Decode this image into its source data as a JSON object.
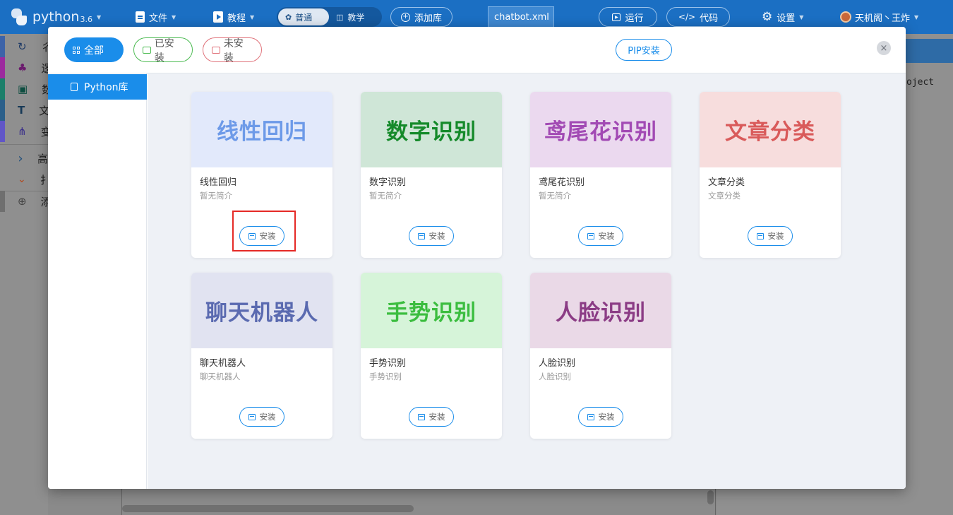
{
  "topbar": {
    "app_name": "python",
    "app_version": "3.6",
    "file_menu": "文件",
    "tutorial_menu": "教程",
    "mode_normal": "普通",
    "mode_teach": "教学",
    "add_library": "添加库",
    "open_file": "chatbot.xml",
    "run": "运行",
    "code": "代码",
    "settings": "设置",
    "user": "天机阁丶王炸"
  },
  "sidebar": {
    "items": [
      {
        "icon": "refresh-icon",
        "glyph": "↻",
        "label": "彳",
        "color": "#3d63a8"
      },
      {
        "icon": "tree-icon",
        "glyph": "♣",
        "label": "逻",
        "color": "#9c2a9e"
      },
      {
        "icon": "calculator-icon",
        "glyph": "▣",
        "label": "数",
        "color": "#1c7f6a"
      },
      {
        "icon": "text-icon",
        "glyph": "T",
        "label": "文",
        "color": "#2b5f8a"
      },
      {
        "icon": "variable-icon",
        "glyph": "⋔",
        "label": "变",
        "color": "#6156c7"
      },
      {
        "icon": "chevron-right-icon",
        "glyph": "›",
        "label": "高",
        "color": "#888888"
      },
      {
        "icon": "chevron-down-icon",
        "glyph": "⌄",
        "label": "扌",
        "color": "#888888"
      },
      {
        "icon": "plus-circle-icon",
        "glyph": "⊕",
        "label": "添",
        "color": "#7a7a7a"
      }
    ]
  },
  "background": {
    "code_snippet": "oject"
  },
  "modal": {
    "filters": {
      "all": "全部",
      "installed": "已安装",
      "not_installed": "未安装"
    },
    "pip_install": "PIP安装",
    "close": "×",
    "nav": {
      "python_lib": "Python库"
    },
    "cards": [
      {
        "banner": "线性回归",
        "name": "线性回归",
        "desc": "暂无简介",
        "button": "安装",
        "banner_bg": "#e2e9fb",
        "banner_color": "#6d9ae8"
      },
      {
        "banner": "数字识别",
        "name": "数字识别",
        "desc": "暂无简介",
        "button": "安装",
        "banner_bg": "#cfe6d7",
        "banner_color": "#158a2a"
      },
      {
        "banner": "鸢尾花识别",
        "name": "鸢尾花识别",
        "desc": "暂无简介",
        "button": "安装",
        "banner_bg": "#ebd9ef",
        "banner_color": "#a24ab4"
      },
      {
        "banner": "文章分类",
        "name": "文章分类",
        "desc": "文章分类",
        "button": "安装",
        "banner_bg": "#f7dddd",
        "banner_color": "#d95a5a"
      },
      {
        "banner": "聊天机器人",
        "name": "聊天机器人",
        "desc": "聊天机器人",
        "button": "安装",
        "banner_bg": "#e1e3f1",
        "banner_color": "#5a6ab0"
      },
      {
        "banner": "手势识别",
        "name": "手势识别",
        "desc": "手势识别",
        "button": "安装",
        "banner_bg": "#d6f4d9",
        "banner_color": "#3bbd3f"
      },
      {
        "banner": "人脸识别",
        "name": "人脸识别",
        "desc": "人脸识别",
        "button": "安装",
        "banner_bg": "#ead9e7",
        "banner_color": "#8b3c85"
      }
    ]
  }
}
